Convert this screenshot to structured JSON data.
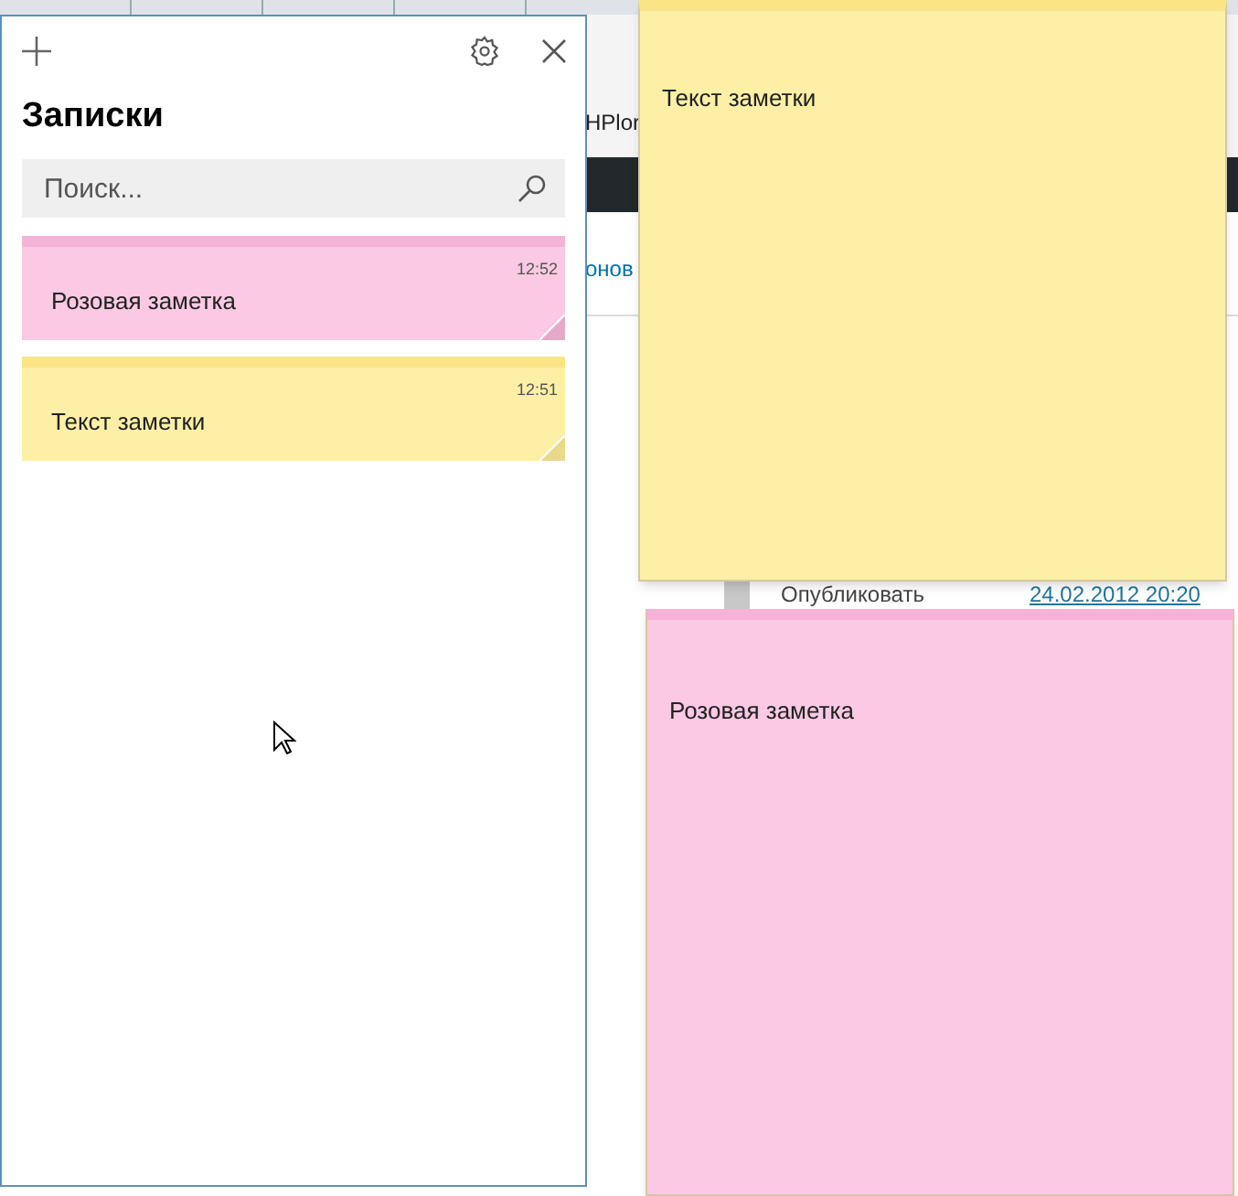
{
  "background_page": {
    "site_name": "HPlor",
    "link": "онов",
    "publish_label": "Опубликовать",
    "publish_date": "24.02.2012 20:20"
  },
  "notes_panel": {
    "title": "Записки",
    "search": {
      "placeholder": "Поиск..."
    },
    "notes": [
      {
        "text": "Розовая заметка",
        "time": "12:52",
        "color": "#fbc9e4"
      },
      {
        "text": "Текст заметки",
        "time": "12:51",
        "color": "#fdf0a6"
      }
    ]
  },
  "open_notes": [
    {
      "text": "Текст заметки",
      "color": "#fdf0a6"
    },
    {
      "text": "Розовая заметка",
      "color": "#fbc9e4"
    }
  ]
}
